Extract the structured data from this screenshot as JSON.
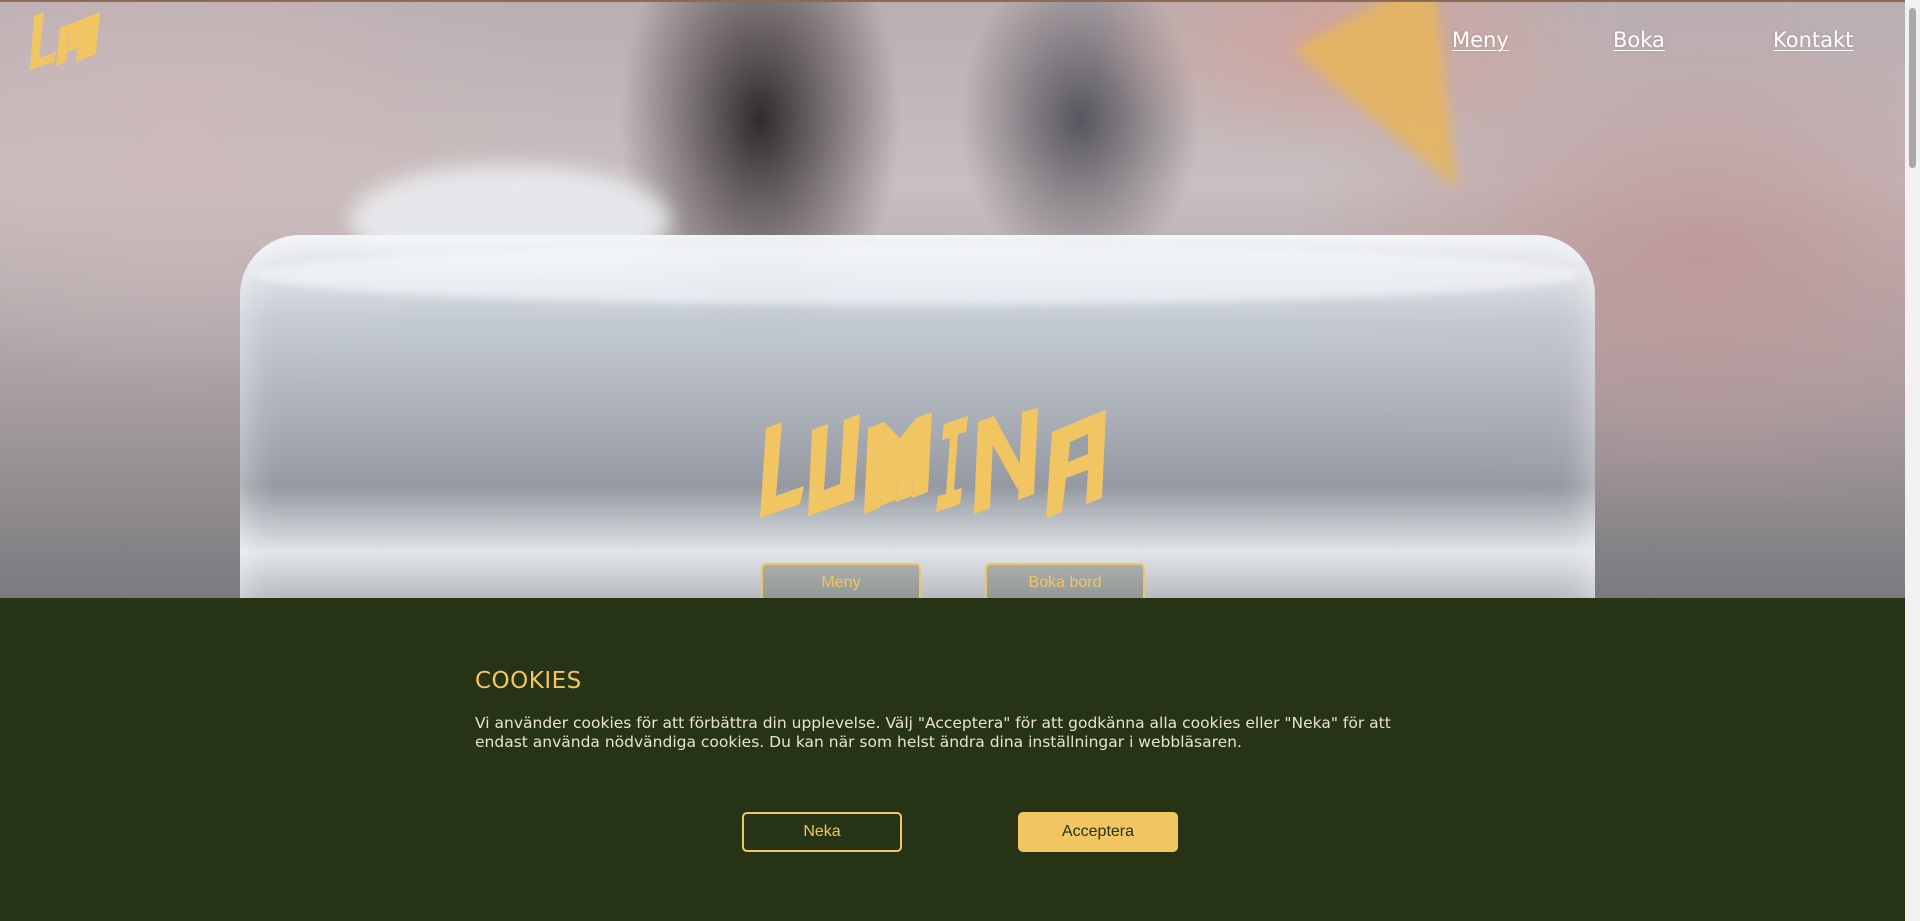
{
  "brand": {
    "logo_text": "LM",
    "wordmark_text": "LUMINA",
    "accent_color": "#f2c563",
    "dark_green": "#263315"
  },
  "nav": {
    "items": [
      {
        "label": "Meny"
      },
      {
        "label": "Boka"
      },
      {
        "label": "Kontakt"
      }
    ]
  },
  "hero": {
    "buttons": {
      "menu": "Meny",
      "book": "Boka bord"
    }
  },
  "cookies": {
    "title": "COOKIES",
    "text": "Vi använder cookies för att förbättra din upplevelse. Välj \"Acceptera\" för att godkänna alla cookies eller \"Neka\" för att endast använda nödvändiga cookies. Du kan när som helst ändra dina inställningar i webbläsaren.",
    "deny_label": "Neka",
    "accept_label": "Acceptera"
  }
}
